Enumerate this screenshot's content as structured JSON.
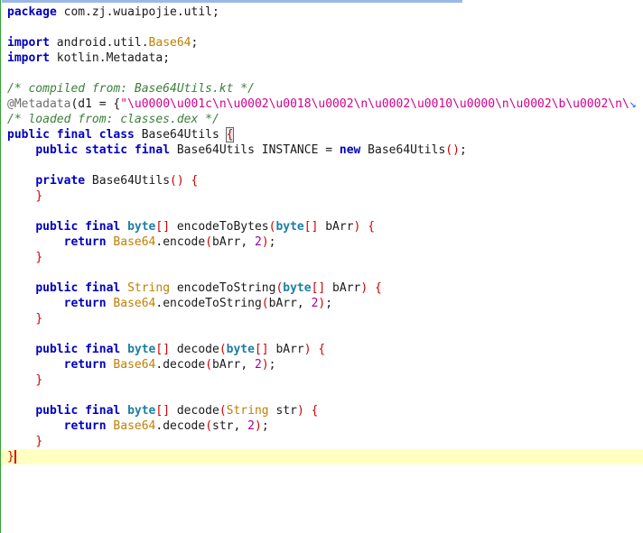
{
  "window": {
    "accent_top": "#9bb7e6",
    "border_left": "#35a335"
  },
  "code": {
    "l1": {
      "kw": "package",
      "rest": " com.zj.wuaipojie.util;"
    },
    "l3": {
      "kw": "import",
      "pkg": " android.util.",
      "cls": "Base64",
      "end": ";"
    },
    "l4": {
      "kw": "import",
      "rest": " kotlin.Metadata;"
    },
    "l6": {
      "comment": "/* compiled from: Base64Utils.kt */"
    },
    "l7": {
      "ann": "@Metadata",
      "p1": "(d1 = {",
      "str": "\"\\u0000\\u001c\\n\\u0002\\u0018\\u0002\\n\\u0002\\u0010\\u0000\\n\\u0002\\b\\u0002\\n\\",
      "wrap": "↘"
    },
    "l8": {
      "comment": "/* loaded from: classes.dex */"
    },
    "l9": {
      "kw": "public final class",
      "name": " Base64Utils ",
      "brace": "{"
    },
    "l10": {
      "kw": "public static final",
      "a": " Base64Utils INSTANCE = ",
      "kw2": "new",
      "b": " Base64Utils",
      "paren": "()",
      "end": ";"
    },
    "l12": {
      "kw": "private",
      "a": " Base64Utils",
      "paren": "()",
      "space": " ",
      "brace": "{"
    },
    "l13": {
      "brace": "}"
    },
    "l15": {
      "kw": "public final",
      "prim": "byte",
      "brk": "[]",
      "a": " encodeToBytes",
      "po": "(",
      "prim2": "byte",
      "brk2": "[]",
      "b": " bArr",
      "pc": ")",
      "space": " ",
      "brace": "{"
    },
    "l16": {
      "kw": "return",
      "cls": "Base64",
      "a": ".encode",
      "po": "(",
      "b": "bArr, ",
      "num": "2",
      "pc": ")",
      "end": ";"
    },
    "l17": {
      "brace": "}"
    },
    "l19": {
      "kw": "public final",
      "cls": "String",
      "a": " encodeToString",
      "po": "(",
      "prim": "byte",
      "brk": "[]",
      "b": " bArr",
      "pc": ")",
      "space": " ",
      "brace": "{"
    },
    "l20": {
      "kw": "return",
      "cls": "Base64",
      "a": ".encodeToString",
      "po": "(",
      "b": "bArr, ",
      "num": "2",
      "pc": ")",
      "end": ";"
    },
    "l21": {
      "brace": "}"
    },
    "l23": {
      "kw": "public final",
      "prim": "byte",
      "brk": "[]",
      "a": " decode",
      "po": "(",
      "prim2": "byte",
      "brk2": "[]",
      "b": " bArr",
      "pc": ")",
      "space": " ",
      "brace": "{"
    },
    "l24": {
      "kw": "return",
      "cls": "Base64",
      "a": ".decode",
      "po": "(",
      "b": "bArr, ",
      "num": "2",
      "pc": ")",
      "end": ";"
    },
    "l25": {
      "brace": "}"
    },
    "l27": {
      "kw": "public final",
      "prim": "byte",
      "brk": "[]",
      "a": " decode",
      "po": "(",
      "cls": "String",
      "b": " str",
      "pc": ")",
      "space": " ",
      "brace": "{"
    },
    "l28": {
      "kw": "return",
      "cls": "Base64",
      "a": ".decode",
      "po": "(",
      "b": "str, ",
      "num": "2",
      "pc": ")",
      "end": ";"
    },
    "l29": {
      "brace": "}"
    },
    "l30": {
      "brace": "}"
    }
  }
}
